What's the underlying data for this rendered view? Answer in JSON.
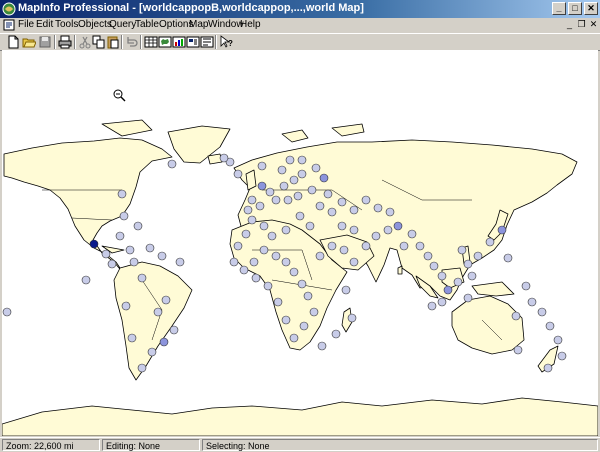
{
  "window": {
    "title": "MapInfo Professional - [worldcappopB,worldcappop,...,world Map]"
  },
  "menu": {
    "items": [
      {
        "label": "File"
      },
      {
        "label": "Edit"
      },
      {
        "label": "Tools"
      },
      {
        "label": "Objects"
      },
      {
        "label": "Query"
      },
      {
        "label": "Table"
      },
      {
        "label": "Options"
      },
      {
        "label": "Map"
      },
      {
        "label": "Window"
      },
      {
        "label": "Help"
      }
    ]
  },
  "toolbar": {
    "buttons": [
      "new-icon",
      "open-icon",
      "save-icon",
      "print-icon",
      "cut-icon",
      "copy-icon",
      "paste-icon",
      "undo-icon",
      "new-browser-icon",
      "new-mapper-icon",
      "new-grapher-icon",
      "new-layout-icon",
      "new-redistricter-icon",
      "help-pointer-icon"
    ]
  },
  "map": {
    "tool": "zoom-out-icon",
    "colors": {
      "land": "#fffbd6",
      "outline": "#000000",
      "city_light": "#c8cce8",
      "city_medium": "#8c94dc",
      "city_dark": "#0a1a8c"
    }
  },
  "status": {
    "zoom": "Zoom: 22,600 mi",
    "editing": "Editing: None",
    "selecting": "Selecting: None"
  }
}
